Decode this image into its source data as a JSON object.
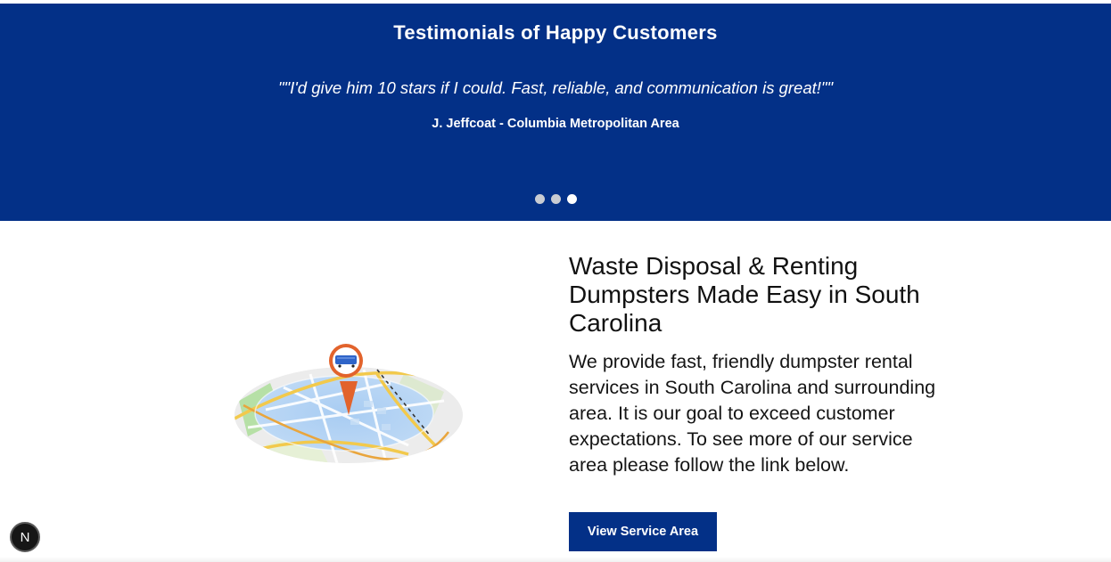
{
  "testimonials": {
    "heading": "Testimonials of Happy Customers",
    "quote": "\"\"I'd give him 10 stars if I could. Fast, reliable, and communication is great!\"\"",
    "author": "J. Jeffcoat - Columbia Metropolitan Area",
    "slide_count": 3,
    "active_slide": 3
  },
  "main": {
    "title": "Waste Disposal & Renting Dumpsters Made Easy in South Carolina",
    "description": "We provide fast, friendly dumpster rental services in South Carolina and surrounding area. It is our goal to exceed customer expectations. To see more of our service area please follow the link below.",
    "cta_label": "View Service Area",
    "illustration_icon": "map-location-pin-icon"
  },
  "badge": {
    "label": "N"
  },
  "colors": {
    "brand_blue": "#033087",
    "pin_orange": "#e2632c",
    "white": "#ffffff"
  }
}
